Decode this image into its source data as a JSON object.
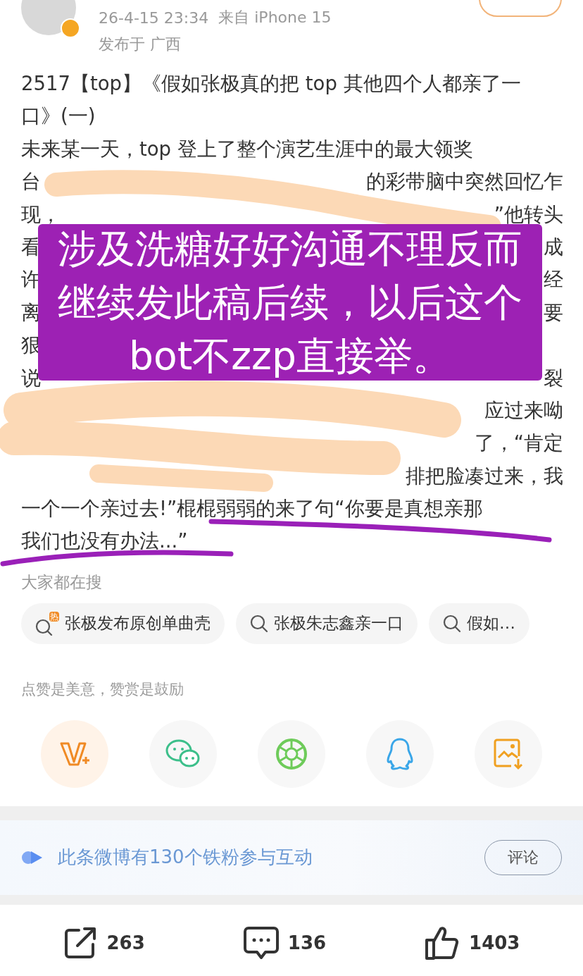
{
  "header": {
    "time": "26-4-15 23:34",
    "source": "来自 iPhone 15",
    "location": "发布于 广西",
    "verified": true
  },
  "post": {
    "lines": [
      {
        "left": "2517【top】《假如张极真的把 top 其他四个人都亲了一"
      },
      {
        "left": "口》(一)"
      },
      {
        "left": "未来某一天，top 登上了整个演艺生涯中的最大领奖"
      },
      {
        "left": "台",
        "right": "的彩带脑中突然回忆乍"
      },
      {
        "left": "现，",
        "right": "”他转头"
      },
      {
        "left": "看",
        "right": "成"
      },
      {
        "left": "许",
        "right": "经"
      },
      {
        "left": "离",
        "right": "要"
      },
      {
        "left": "狠"
      },
      {
        "left": "说",
        "right": "裂"
      },
      {
        "right": "应过来呦"
      },
      {
        "right": "了，“肯定"
      },
      {
        "right": "排把脸凑过来，我"
      },
      {
        "left": "一个一个亲过去!”棍棍弱弱的来了句“你要是真想亲那"
      },
      {
        "left": "我们也没有办法...”"
      }
    ]
  },
  "annotation": {
    "text": "涉及洗糖好好沟通不理反而继续发此稿后续，以后这个bot不zzp直接举。"
  },
  "hot_search": {
    "title": "大家都在搜",
    "chips": [
      {
        "kind": "hot",
        "badge": "热",
        "text": "张极发布原创单曲壳"
      },
      {
        "kind": "search",
        "text": "张极朱志鑫亲一口"
      },
      {
        "kind": "search",
        "text": "假如…"
      }
    ]
  },
  "reward": {
    "text": "点赞是美意，赞赏是鼓励"
  },
  "share": [
    {
      "kind": "reward"
    },
    {
      "kind": "wechat"
    },
    {
      "kind": "moments"
    },
    {
      "kind": "qq"
    },
    {
      "kind": "save"
    }
  ],
  "fans_banner": {
    "text": "此条微博有130个铁粉参与互动",
    "button": "评论"
  },
  "actions": [
    {
      "kind": "repost",
      "count": "263"
    },
    {
      "kind": "comment",
      "count": "136"
    },
    {
      "kind": "like",
      "count": "1403"
    }
  ]
}
